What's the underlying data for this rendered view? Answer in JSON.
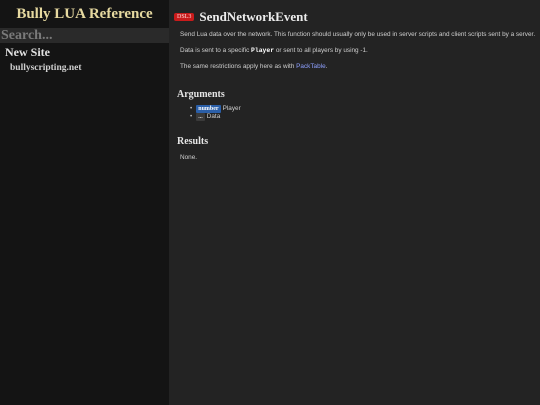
{
  "sidebar": {
    "site_title": "Bully LUA Reference",
    "search_placeholder": "Search...",
    "section_heading": "New Site",
    "site_link": "bullyscripting.net"
  },
  "page": {
    "badge": "DSL3",
    "title": "SendNetworkEvent",
    "desc1": "Send Lua data over the network. This function should usually only be used in server scripts and client scripts sent by a server.",
    "desc2_pre": "Data is sent to a specific ",
    "desc2_code": "Player",
    "desc2_post": " or sent to all players by using -1.",
    "desc3_pre": "The same restrictions apply here as with ",
    "desc3_link": "PackTable",
    "desc3_post": ".",
    "arguments_heading": "Arguments",
    "arguments": [
      {
        "type": "number",
        "name": "Player"
      },
      {
        "type": "...",
        "name": "Data"
      }
    ],
    "results_heading": "Results",
    "results_text": "None."
  },
  "colors": {
    "badge_bg": "#c91b1b",
    "number_tag": "#2b5fa8",
    "link": "#8ea0ff",
    "sidebar_bg": "#141414",
    "content_bg": "#232323"
  }
}
